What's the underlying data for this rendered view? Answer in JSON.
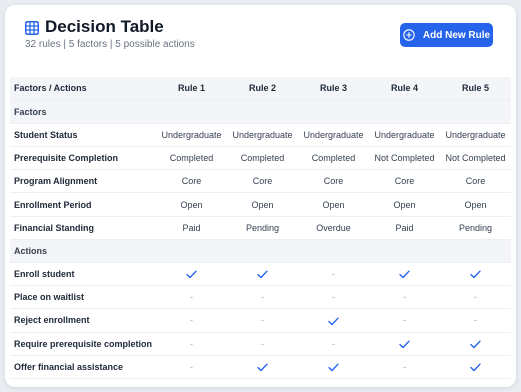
{
  "header": {
    "title": "Decision Table",
    "subtitle": "32 rules | 5 factors | 5 possible actions",
    "add_button_label": "Add New Rule"
  },
  "table": {
    "corner_label": "Factors / Actions",
    "rules": [
      "Rule 1",
      "Rule 2",
      "Rule 3",
      "Rule 4",
      "Rule 5"
    ],
    "factors_section_label": "Factors",
    "factors": [
      {
        "name": "Student Status",
        "values": [
          "Undergraduate",
          "Undergraduate",
          "Undergraduate",
          "Undergraduate",
          "Undergraduate"
        ]
      },
      {
        "name": "Prerequisite Completion",
        "values": [
          "Completed",
          "Completed",
          "Completed",
          "Not Completed",
          "Not Completed"
        ]
      },
      {
        "name": "Program Alignment",
        "values": [
          "Core",
          "Core",
          "Core",
          "Core",
          "Core"
        ]
      },
      {
        "name": "Enrollment Period",
        "values": [
          "Open",
          "Open",
          "Open",
          "Open",
          "Open"
        ]
      },
      {
        "name": "Financial Standing",
        "values": [
          "Paid",
          "Pending",
          "Overdue",
          "Paid",
          "Pending"
        ]
      }
    ],
    "actions_section_label": "Actions",
    "dash_symbol": "-",
    "actions": [
      {
        "name": "Enroll student",
        "values": [
          true,
          true,
          false,
          true,
          true
        ]
      },
      {
        "name": "Place on waitlist",
        "values": [
          false,
          false,
          false,
          false,
          false
        ]
      },
      {
        "name": "Reject enrollment",
        "values": [
          false,
          false,
          true,
          false,
          false
        ]
      },
      {
        "name": "Require prerequisite completion",
        "values": [
          false,
          false,
          false,
          true,
          true
        ]
      },
      {
        "name": "Offer financial assistance",
        "values": [
          false,
          true,
          true,
          false,
          true
        ]
      }
    ]
  },
  "colors": {
    "accent": "#2563eb",
    "check": "#2563eb",
    "section_bg": "#f3f5f8"
  },
  "icons": {
    "title": "table-grid-icon",
    "add_button": "plus-circle-icon",
    "check": "check-icon"
  }
}
